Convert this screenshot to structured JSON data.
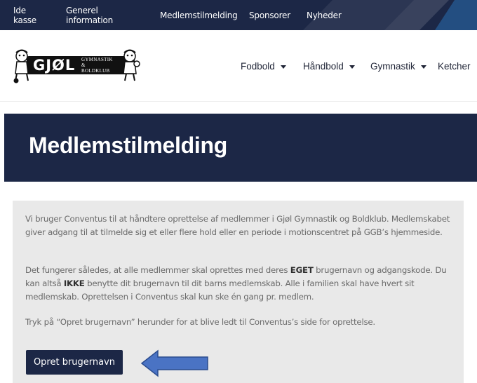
{
  "topnav": {
    "items": [
      "Ide kasse",
      "Generel information",
      "Medlemstilmelding",
      "Sponsorer",
      "Nyheder"
    ]
  },
  "logo": {
    "name": "GJØL",
    "sub1": "GYMNASTIK",
    "sub2": "&",
    "sub3": "BOLDKLUB"
  },
  "mainnav": {
    "items": [
      "Fodbold",
      "Håndbold",
      "Gymnastik",
      "Ketcher"
    ]
  },
  "page": {
    "title": "Medlemstilmelding"
  },
  "content": {
    "p1": "Vi bruger Conventus til at håndtere oprettelse af medlemmer i Gjøl Gymnastik og Boldklub. Medlemskabet giver adgang til at tilmelde sig et eller flere hold eller en periode i motionscentret på GGB’s hjemmeside.",
    "p2_a": "Det fungerer således, at alle medlemmer skal oprettes med deres ",
    "p2_bold1": "EGET",
    "p2_b": " brugernavn og adgangskode. Du kan altså ",
    "p2_bold2": "IKKE",
    "p2_c": " benytte dit brugernavn til dit barns medlemskab. Alle i familien skal have hvert sit medlemskab. Oprettelsen i Conventus skal kun ske én gang pr. medlem.",
    "p3": "Tryk på “Opret brugernavn” herunder for at blive ledt til Conventus’s side for oprettelse.",
    "button_label": "Opret brugernavn"
  },
  "colors": {
    "navy": "#1c2746",
    "panel": "#e9e9e9",
    "text": "#6a6a6a",
    "arrow": "#4a73c4"
  }
}
